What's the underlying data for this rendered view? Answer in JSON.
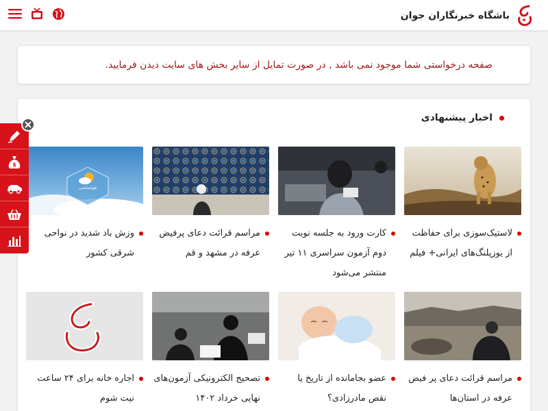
{
  "header": {
    "site_name": "باشگاه خبرنگاران جوان",
    "icons": [
      "menu-icon",
      "tv-icon",
      "globe-icon"
    ]
  },
  "notice": {
    "message": "صفحه درخواستی شما موجود نمی باشد , در صورت تمایل از سایر بخش های سایت دیدن فرمایید."
  },
  "recommended": {
    "title": "اخبار پیشنهادی",
    "items": [
      {
        "title": "لاستیک‌سوزی برای حفاظت از یوزپلنگ‌های ایرانی+ فیلم",
        "thumb": "cheetah"
      },
      {
        "title": "کارت ورود به جلسه نوبت دوم آزمون سراسری ۱۱ تیر منتشر می‌شود",
        "thumb": "exam-hall"
      },
      {
        "title": "مراسم قرائت دعای پرفیض عرفه در مشهد و قم",
        "thumb": "shrine-wall"
      },
      {
        "title": "وزش باد شدید در نواحی شرقی کشور",
        "thumb": "weather",
        "thumb_label": "هواشناسی"
      },
      {
        "title": "مراسم قرائت دعای پر فیض عرفه در استان‌ها",
        "thumb": "arafah-prayer"
      },
      {
        "title": "عضو بجامانده از تاریخ یا نقص مادرزادی؟",
        "thumb": "baby"
      },
      {
        "title": "تصحیح الکترونیکی آزمون‌های نهایی خرداد ۱۴۰۲",
        "thumb": "students-exam"
      },
      {
        "title": "اجاره خانه برای ۲۴ ساعت نیت شوم",
        "thumb": "ybc-logo"
      }
    ]
  },
  "side_toolbar": {
    "buttons": [
      "pen-icon",
      "money-bag-icon",
      "car-icon",
      "basket-icon",
      "bar-chart-icon"
    ]
  },
  "colors": {
    "accent": "#d6121a",
    "notice_text": "#a01919",
    "dot": "#d80000"
  }
}
